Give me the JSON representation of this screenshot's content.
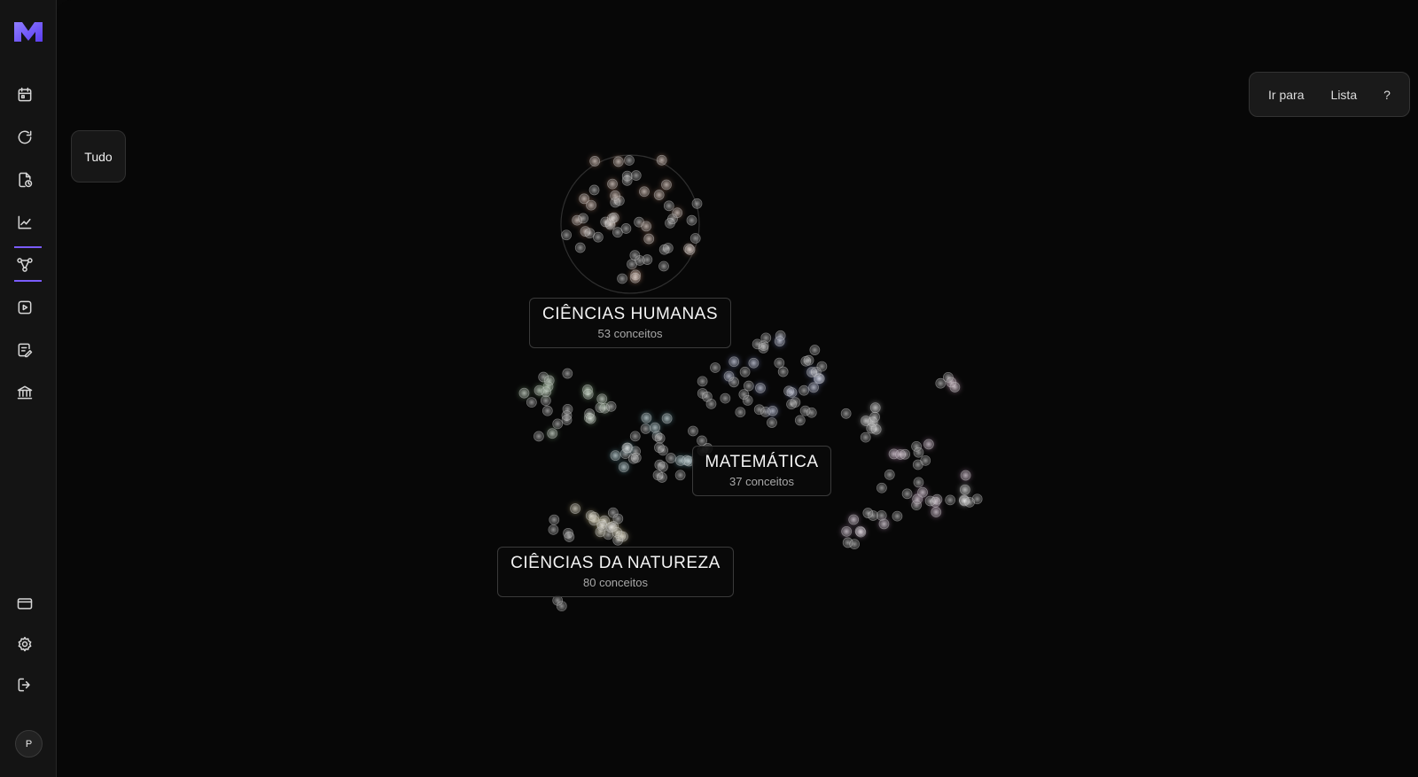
{
  "sidebar": {
    "nav": [
      {
        "icon": "calendar-icon"
      },
      {
        "icon": "refresh-icon"
      },
      {
        "icon": "file-clock-icon"
      },
      {
        "icon": "chart-line-icon"
      },
      {
        "icon": "graph-nodes-icon",
        "active": true
      },
      {
        "icon": "play-square-icon"
      },
      {
        "icon": "edit-note-icon"
      },
      {
        "icon": "bank-icon"
      }
    ],
    "bottom": [
      {
        "icon": "credit-card-icon"
      },
      {
        "icon": "settings-gear-icon"
      },
      {
        "icon": "logout-icon"
      }
    ],
    "avatar": "P",
    "accent_color": "#7a5cff"
  },
  "filter": {
    "label": "Tudo"
  },
  "topbar": {
    "goto_label": "Ir para",
    "list_label": "Lista",
    "help_label": "?"
  },
  "clusters": [
    {
      "title": "CIÊNCIAS HUMANAS",
      "count": "53 conceitos"
    },
    {
      "title": "MATEMÁTICA",
      "count": "37 conceitos"
    },
    {
      "title": "CIÊNCIAS DA NATUREZA",
      "count": "80 conceitos"
    }
  ]
}
